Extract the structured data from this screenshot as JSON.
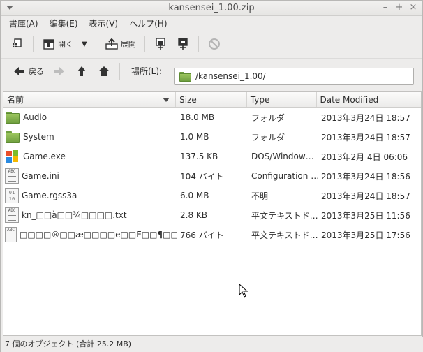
{
  "window": {
    "title": "kansensei_1.00.zip"
  },
  "menu": [
    "書庫(A)",
    "編集(E)",
    "表示(V)",
    "ヘルプ(H)"
  ],
  "toolbar": {
    "open_label": "開く",
    "extract_label": "展開"
  },
  "nav": {
    "back_label": "戻る",
    "location_label": "場所(L):",
    "path": "/kansensei_1.00/"
  },
  "columns": {
    "name": "名前",
    "size": "Size",
    "type": "Type",
    "modified": "Date Modified"
  },
  "files": [
    {
      "name": "Audio",
      "size": "18.0 MB",
      "type": "フォルダ",
      "modified": "2013年3月24日 18:57",
      "icon": "folder-icon"
    },
    {
      "name": "System",
      "size": "1.0 MB",
      "type": "フォルダ",
      "modified": "2013年3月24日 18:57",
      "icon": "folder-icon"
    },
    {
      "name": "Game.exe",
      "size": "137.5 KB",
      "type": "DOS/Window…",
      "modified": "2013年2月 4日 06:06",
      "icon": "exe-icon"
    },
    {
      "name": "Game.ini",
      "size": "104 バイト",
      "type": "Configuration …",
      "modified": "2013年3月24日 18:56",
      "icon": "text-file-icon"
    },
    {
      "name": "Game.rgss3a",
      "size": "6.0 MB",
      "type": "不明",
      "modified": "2013年3月24日 18:57",
      "icon": "binary-file-icon"
    },
    {
      "name": "kn_□□à□□¾□□□□.txt",
      "size": "2.8 KB",
      "type": "平文テキストド…",
      "modified": "2013年3月25日 11:56",
      "icon": "text-file-icon"
    },
    {
      "name": "□□□□®□□æ□□□□e□□E□□¶□□ú□□…",
      "size": "766 バイト",
      "type": "平文テキストド…",
      "modified": "2013年3月25日 17:56",
      "icon": "text-file-icon"
    }
  ],
  "status": "7 個のオブジェクト (合計 25.2 MB)"
}
